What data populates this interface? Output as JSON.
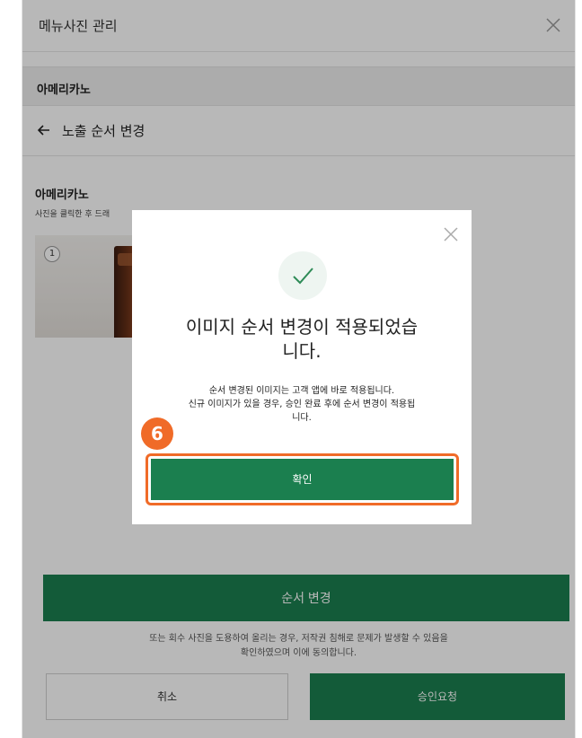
{
  "modal": {
    "title": "메뉴사진 관리"
  },
  "menu_bar": {
    "label": "아메리카노"
  },
  "back_row": {
    "label": "노출 순서 변경"
  },
  "section": {
    "title": "아메리카노",
    "hint": "사진을 클릭한 후 드래"
  },
  "photos": [
    {
      "index": "1"
    }
  ],
  "order_button": {
    "label": "순서 변경"
  },
  "footer": {
    "agree_line_1": "또는 회수 사진을 도용하여 올리는 경우, 저작권 침해로 문제가 발생할 수 있음을",
    "agree_line_2": "확인하였으며 이에 동의합니다.",
    "cancel_label": "취소",
    "approve_label": "승인요청"
  },
  "dialog": {
    "title_line_1": "이미지 순서 변경이 적용되었습",
    "title_line_2": "니다.",
    "desc_line_1": "순서 변경된 이미지는 고객 앱에 바로 적용됩니다.",
    "desc_line_2": "신규 이미지가 있을 경우, 승인 완료 후에 순서 변경이 적용됩",
    "desc_line_3": "니다.",
    "step_number": "6",
    "confirm_label": "확인"
  },
  "colors": {
    "brand_green": "#1b7f4f",
    "highlight_orange": "#f06b28",
    "check_green": "#2e8b57"
  },
  "icons": {
    "header_close": "close-icon",
    "dialog_close": "close-icon",
    "back": "arrow-left-icon",
    "success": "checkmark-icon"
  }
}
